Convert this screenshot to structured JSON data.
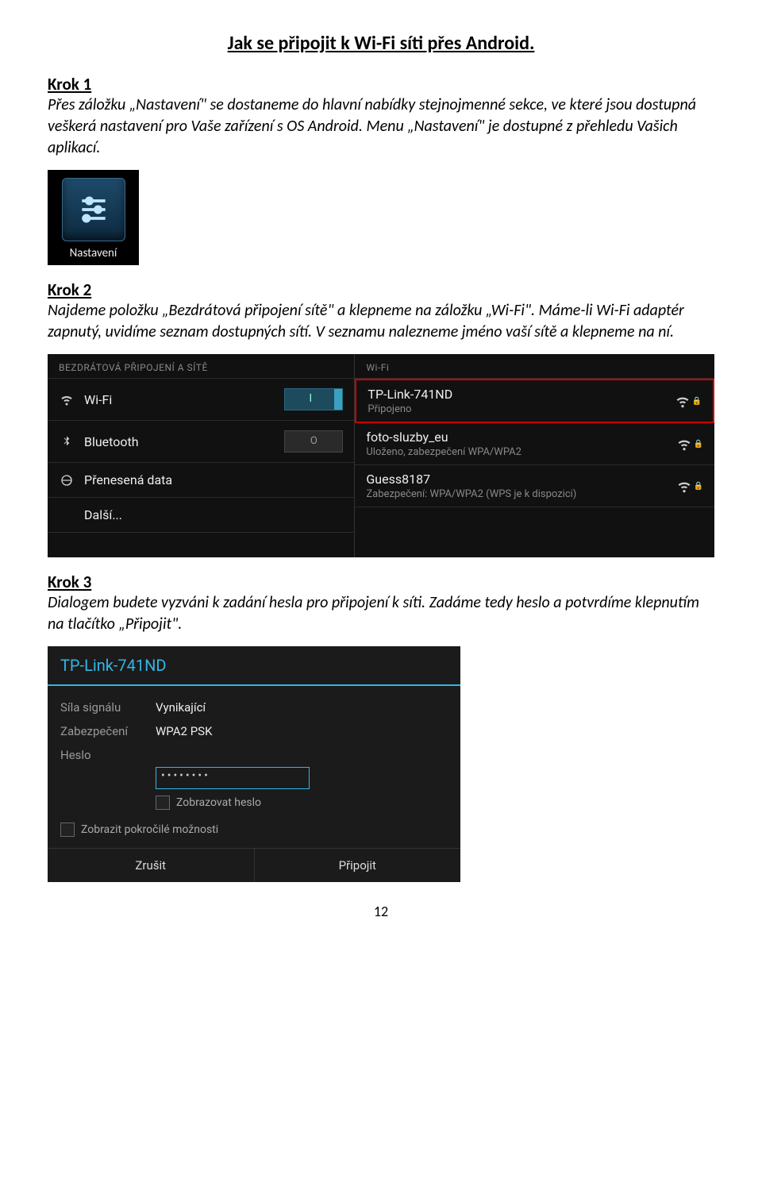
{
  "title": "Jak se připojit k Wi-Fi síti přes Android.",
  "step1": {
    "heading": "Krok 1",
    "body": "Přes záložku „Nastavení\" se dostaneme do hlavní nabídky stejnojmenné sekce, ve které jsou dostupná veškerá nastavení pro Vaše zařízení s OS Android. Menu „Nastavení\" je dostupné z přehledu Vašich aplikací.",
    "icon_label": "Nastavení"
  },
  "step2": {
    "heading": "Krok 2",
    "body": "Najdeme položku „Bezdrátová připojení sítě\" a klepneme na záložku „Wi-Fi\". Máme-li Wi-Fi adaptér zapnutý, uvidíme seznam dostupných sítí. V seznamu nalezneme jméno vaší sítě a klepneme na ní."
  },
  "settings": {
    "left_header": "BEZDRÁTOVÁ PŘIPOJENÍ A SÍTĚ",
    "wifi": "Wi-Fi",
    "bluetooth": "Bluetooth",
    "bluetooth_toggle": "O",
    "data": "Přenesená data",
    "more": "Další...",
    "right_header": "Wi-Fi",
    "networks": [
      {
        "name": "TP-Link-741ND",
        "sub": "Připojeno"
      },
      {
        "name": "foto-sluzby_eu",
        "sub": "Uloženo, zabezpečení WPA/WPA2"
      },
      {
        "name": "Guess8187",
        "sub": "Zabezpečení: WPA/WPA2 (WPS je k dispozici)"
      }
    ]
  },
  "step3": {
    "heading": "Krok 3",
    "body": "Dialogem budete vyzváni k zadání hesla pro připojení k síti. Zadáme tedy heslo a potvrdíme klepnutím na tlačítko „Připojit\"."
  },
  "dialog": {
    "title": "TP-Link-741ND",
    "signal_k": "Síla signálu",
    "signal_v": "Vynikající",
    "security_k": "Zabezpečení",
    "security_v": "WPA2 PSK",
    "pw_k": "Heslo",
    "pw_v": "••••••••",
    "show_pw": "Zobrazovat heslo",
    "advanced": "Zobrazit pokročilé možnosti",
    "cancel": "Zrušit",
    "connect": "Připojit"
  },
  "page_number": "12"
}
